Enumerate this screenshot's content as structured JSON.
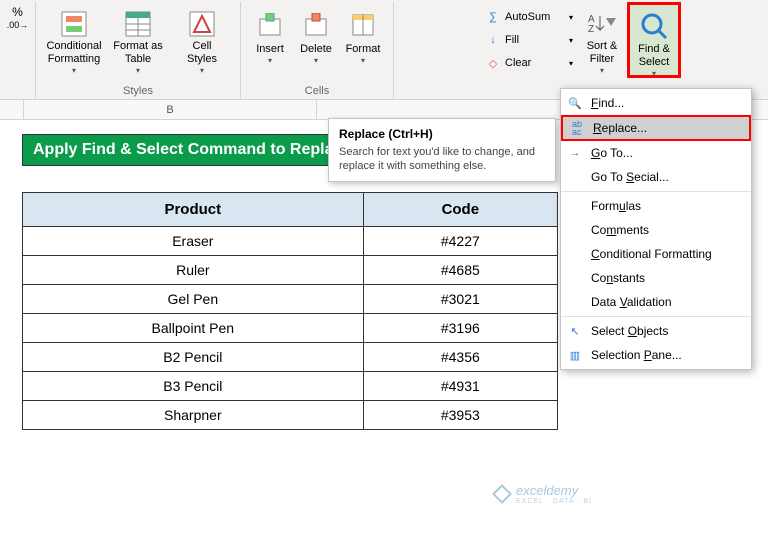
{
  "ribbon": {
    "leftIcons": [
      "num-fmt",
      "decimals"
    ],
    "styles": {
      "groupLabel": "Styles",
      "cond": "Conditional\nFormatting",
      "table": "Format as\nTable",
      "cell": "Cell\nStyles"
    },
    "cells": {
      "groupLabel": "Cells",
      "insert": "Insert",
      "delete": "Delete",
      "format": "Format"
    },
    "editing": {
      "autosum": "AutoSum",
      "fill": "Fill",
      "clear": "Clear",
      "sort": "Sort &\nFilter",
      "find": "Find &\nSelect"
    }
  },
  "tooltip": {
    "title": "Replace (Ctrl+H)",
    "body": "Search for text you'd like to change, and replace it with something else."
  },
  "menu": {
    "find": "Find...",
    "replace": "Replace...",
    "goto": "Go To...",
    "gotoSpecial": "Go To Special...",
    "formulas": "Formulas",
    "comments": "Comments",
    "cond": "Conditional Formatting",
    "constants": "Constants",
    "dv": "Data Validation",
    "selObj": "Select Objects",
    "selPane": "Selection Pane..."
  },
  "column_header": "B",
  "sheet": {
    "title": "Apply Find & Select Command to Replace Special Characters",
    "headers": {
      "product": "Product",
      "code": "Code"
    }
  },
  "chart_data": {
    "type": "table",
    "columns": [
      "Product",
      "Code"
    ],
    "rows": [
      {
        "product": "Eraser",
        "code": "#4227"
      },
      {
        "product": "Ruler",
        "code": "#4685"
      },
      {
        "product": "Gel Pen",
        "code": "#3021"
      },
      {
        "product": "Ballpoint Pen",
        "code": "#3196"
      },
      {
        "product": "B2 Pencil",
        "code": "#4356"
      },
      {
        "product": "B3 Pencil",
        "code": "#4931"
      },
      {
        "product": "Sharpner",
        "code": "#3953"
      }
    ]
  },
  "watermark": {
    "brand": "exceldemy",
    "sub": "EXCEL · DATA · BI"
  }
}
